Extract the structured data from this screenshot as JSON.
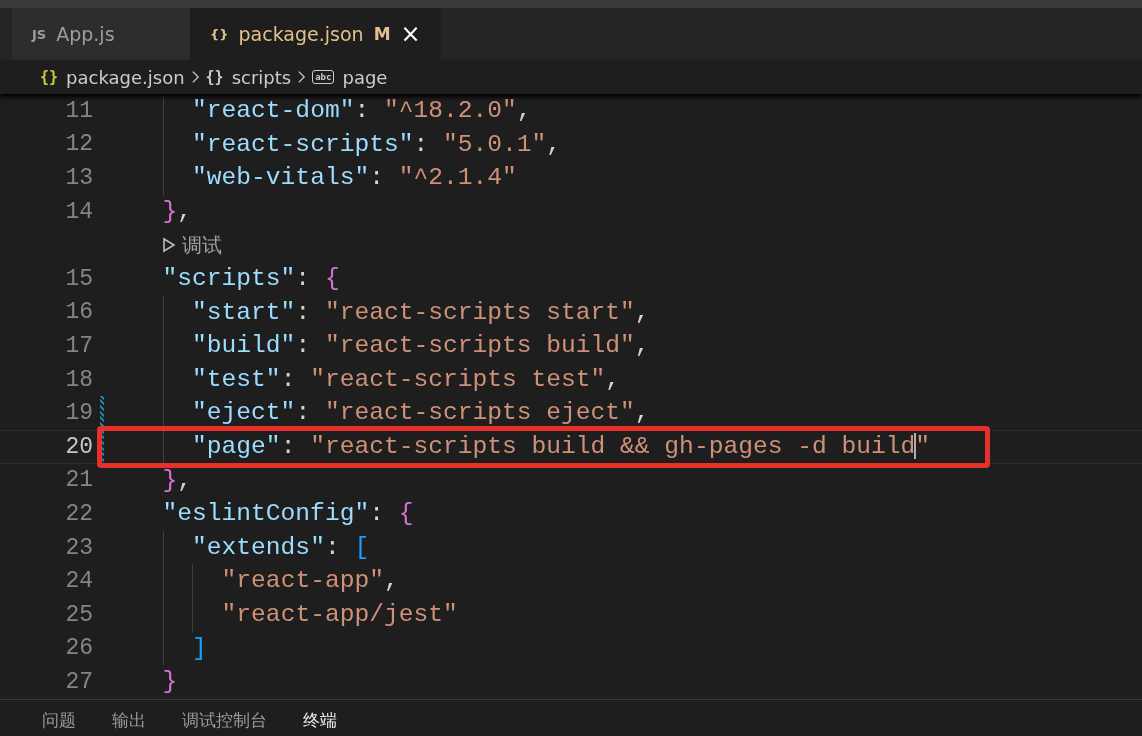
{
  "tabs": [
    {
      "icon_text": "JS",
      "label": "App.js",
      "selected": false
    },
    {
      "icon_text": "{}",
      "label": "package.json",
      "badge": "M",
      "close": "×",
      "selected": true
    }
  ],
  "breadcrumb": [
    {
      "kind": "braces",
      "icon_text": "{}",
      "label": "package.json"
    },
    {
      "kind": "object",
      "icon_text": "{}",
      "label": "scripts"
    },
    {
      "kind": "string",
      "icon_text": "abc",
      "label": "page"
    }
  ],
  "editor": {
    "lines": [
      {
        "kind": "code",
        "number": "11",
        "current": false,
        "modified": false,
        "boxed": false,
        "tokens": [
          {
            "kind": "key",
            "text": "    \"react-dom\""
          },
          {
            "kind": "punct",
            "text": ": "
          },
          {
            "kind": "string",
            "text": "\"^18.2.0\""
          },
          {
            "kind": "punct",
            "text": ","
          }
        ]
      },
      {
        "kind": "code",
        "number": "12",
        "current": false,
        "modified": false,
        "boxed": false,
        "tokens": [
          {
            "kind": "key",
            "text": "    \"react-scripts\""
          },
          {
            "kind": "punct",
            "text": ": "
          },
          {
            "kind": "string",
            "text": "\"5.0.1\""
          },
          {
            "kind": "punct",
            "text": ","
          }
        ]
      },
      {
        "kind": "code",
        "number": "13",
        "current": false,
        "modified": false,
        "boxed": false,
        "tokens": [
          {
            "kind": "key",
            "text": "    \"web-vitals\""
          },
          {
            "kind": "punct",
            "text": ": "
          },
          {
            "kind": "string",
            "text": "\"^2.1.4\""
          }
        ]
      },
      {
        "kind": "code",
        "number": "14",
        "current": false,
        "modified": false,
        "boxed": false,
        "tokens": [
          {
            "kind": "bracket1",
            "text": "  }"
          },
          {
            "kind": "punct",
            "text": ","
          }
        ]
      },
      {
        "kind": "codelens",
        "text": "调试"
      },
      {
        "kind": "code",
        "number": "15",
        "current": false,
        "modified": false,
        "boxed": false,
        "tokens": [
          {
            "kind": "key",
            "text": "  \"scripts\""
          },
          {
            "kind": "punct",
            "text": ": "
          },
          {
            "kind": "bracket1",
            "text": "{"
          }
        ]
      },
      {
        "kind": "code",
        "number": "16",
        "current": false,
        "modified": false,
        "boxed": false,
        "tokens": [
          {
            "kind": "key",
            "text": "    \"start\""
          },
          {
            "kind": "punct",
            "text": ": "
          },
          {
            "kind": "string",
            "text": "\"react-scripts start\""
          },
          {
            "kind": "punct",
            "text": ","
          }
        ]
      },
      {
        "kind": "code",
        "number": "17",
        "current": false,
        "modified": false,
        "boxed": false,
        "tokens": [
          {
            "kind": "key",
            "text": "    \"build\""
          },
          {
            "kind": "punct",
            "text": ": "
          },
          {
            "kind": "string",
            "text": "\"react-scripts build\""
          },
          {
            "kind": "punct",
            "text": ","
          }
        ]
      },
      {
        "kind": "code",
        "number": "18",
        "current": false,
        "modified": false,
        "boxed": false,
        "tokens": [
          {
            "kind": "key",
            "text": "    \"test\""
          },
          {
            "kind": "punct",
            "text": ": "
          },
          {
            "kind": "string",
            "text": "\"react-scripts test\""
          },
          {
            "kind": "punct",
            "text": ","
          }
        ]
      },
      {
        "kind": "code",
        "number": "19",
        "current": false,
        "modified": true,
        "boxed": false,
        "tokens": [
          {
            "kind": "key",
            "text": "    \"eject\""
          },
          {
            "kind": "punct",
            "text": ": "
          },
          {
            "kind": "string",
            "text": "\"react-scripts eject\""
          },
          {
            "kind": "punct",
            "text": ","
          }
        ]
      },
      {
        "kind": "code",
        "number": "20",
        "current": true,
        "modified": true,
        "boxed": true,
        "tokens": [
          {
            "kind": "key",
            "text": "    \"page\""
          },
          {
            "kind": "punct",
            "text": ": "
          },
          {
            "kind": "string",
            "text": "\"react-scripts build && gh-pages -d build\""
          }
        ]
      },
      {
        "kind": "code",
        "number": "21",
        "current": false,
        "modified": false,
        "boxed": false,
        "tokens": [
          {
            "kind": "bracket1",
            "text": "  }"
          },
          {
            "kind": "punct",
            "text": ","
          }
        ]
      },
      {
        "kind": "code",
        "number": "22",
        "current": false,
        "modified": false,
        "boxed": false,
        "tokens": [
          {
            "kind": "key",
            "text": "  \"eslintConfig\""
          },
          {
            "kind": "punct",
            "text": ": "
          },
          {
            "kind": "bracket1",
            "text": "{"
          }
        ]
      },
      {
        "kind": "code",
        "number": "23",
        "current": false,
        "modified": false,
        "boxed": false,
        "tokens": [
          {
            "kind": "key",
            "text": "    \"extends\""
          },
          {
            "kind": "punct",
            "text": ": "
          },
          {
            "kind": "bracket2",
            "text": "["
          }
        ]
      },
      {
        "kind": "code",
        "number": "24",
        "current": false,
        "modified": false,
        "boxed": false,
        "tokens": [
          {
            "kind": "string",
            "text": "      \"react-app\""
          },
          {
            "kind": "punct",
            "text": ","
          }
        ]
      },
      {
        "kind": "code",
        "number": "25",
        "current": false,
        "modified": false,
        "boxed": false,
        "tokens": [
          {
            "kind": "string",
            "text": "      \"react-app/jest\""
          }
        ]
      },
      {
        "kind": "code",
        "number": "26",
        "current": false,
        "modified": false,
        "boxed": false,
        "tokens": [
          {
            "kind": "bracket2",
            "text": "    ]"
          }
        ]
      },
      {
        "kind": "code",
        "number": "27",
        "current": false,
        "modified": false,
        "boxed": false,
        "tokens": [
          {
            "kind": "bracket1",
            "text": "  }"
          }
        ]
      }
    ]
  },
  "panel_tabs": [
    {
      "label": "问题",
      "selected": false
    },
    {
      "label": "输出",
      "selected": false
    },
    {
      "label": "调试控制台",
      "selected": false
    },
    {
      "label": "终端",
      "selected": true
    }
  ]
}
